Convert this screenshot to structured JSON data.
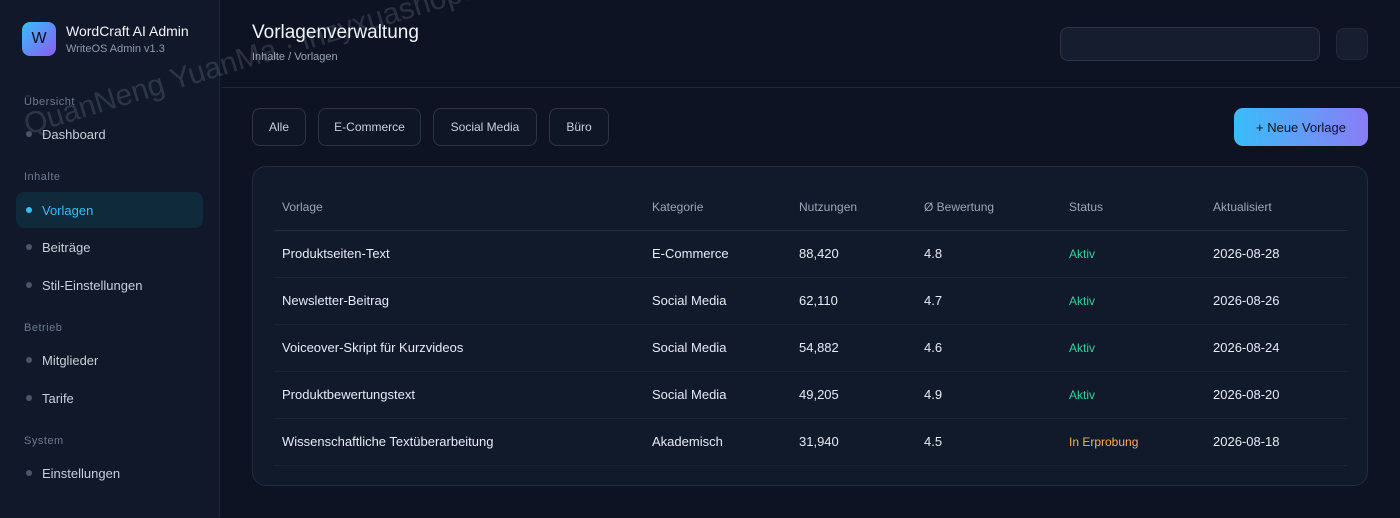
{
  "brand": {
    "logo_letter": "W",
    "name": "WordCraft AI Admin",
    "version": "WriteOS Admin v1.3"
  },
  "sidebar": {
    "sections": [
      {
        "title": "Übersicht",
        "items": [
          {
            "label": "Dashboard",
            "active": false
          }
        ]
      },
      {
        "title": "Inhalte",
        "items": [
          {
            "label": "Vorlagen",
            "active": true
          },
          {
            "label": "Beiträge",
            "active": false
          },
          {
            "label": "Stil-Einstellungen",
            "active": false
          }
        ]
      },
      {
        "title": "Betrieb",
        "items": [
          {
            "label": "Mitglieder",
            "active": false
          },
          {
            "label": "Tarife",
            "active": false
          }
        ]
      },
      {
        "title": "System",
        "items": [
          {
            "label": "Einstellungen",
            "active": false
          }
        ]
      }
    ]
  },
  "header": {
    "title": "Vorlagenverwaltung",
    "breadcrumb": "Inhalte / Vorlagen",
    "search_value": ""
  },
  "filters": [
    "Alle",
    "E-Commerce",
    "Social Media",
    "Büro"
  ],
  "new_button": "+ Neue Vorlage",
  "table": {
    "columns": [
      "Vorlage",
      "Kategorie",
      "Nutzungen",
      "Ø Bewertung",
      "Status",
      "Aktualisiert"
    ],
    "rows": [
      [
        "Produktseiten-Text",
        "E-Commerce",
        "88,420",
        "4.8",
        "Aktiv",
        "2026-08-28"
      ],
      [
        "Newsletter-Beitrag",
        "Social Media",
        "62,110",
        "4.7",
        "Aktiv",
        "2026-08-26"
      ],
      [
        "Voiceover-Skript für Kurzvideos",
        "Social Media",
        "54,882",
        "4.6",
        "Aktiv",
        "2026-08-24"
      ],
      [
        "Produktbewertungstext",
        "Social Media",
        "49,205",
        "4.9",
        "Aktiv",
        "2026-08-20"
      ],
      [
        "Wissenschaftliche Textüberarbeitung",
        "Akademisch",
        "31,940",
        "4.5",
        "In Erprobung",
        "2026-08-18"
      ]
    ]
  },
  "colors": {
    "accent": "#38bdf8",
    "status_active": "#34d399",
    "status_trial": "#f0b35b"
  },
  "watermark": "QuanNeng YuanMa · inzyxuashop.com"
}
